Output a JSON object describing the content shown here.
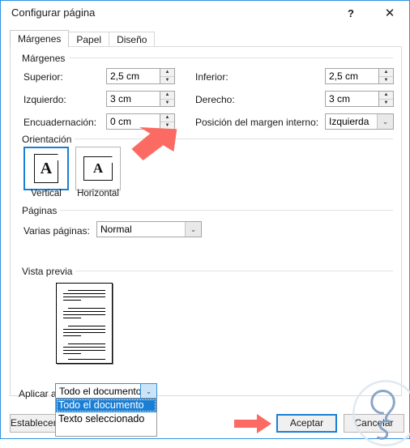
{
  "window": {
    "title": "Configurar página",
    "help_label": "?",
    "close_label": "✕"
  },
  "tabs": [
    {
      "label": "Márgenes",
      "active": true
    },
    {
      "label": "Papel",
      "active": false
    },
    {
      "label": "Diseño",
      "active": false
    }
  ],
  "margins_group": {
    "legend": "Márgenes",
    "fields": [
      {
        "label": "Superior:",
        "value": "2,5 cm",
        "control": "spinner"
      },
      {
        "label": "Izquierdo:",
        "value": "3 cm",
        "control": "spinner"
      },
      {
        "label": "Encuadernación:",
        "value": "0 cm",
        "control": "spinner"
      },
      {
        "label": "Inferior:",
        "value": "2,5 cm",
        "control": "spinner"
      },
      {
        "label": "Derecho:",
        "value": "3 cm",
        "control": "spinner"
      },
      {
        "label": "Posición del margen interno:",
        "value": "Izquierda",
        "control": "combo"
      }
    ],
    "spin_up": "▲",
    "spin_down": "▼"
  },
  "orientation_group": {
    "legend": "Orientación",
    "options": [
      {
        "label": "Vertical",
        "selected": true,
        "glyph": "A"
      },
      {
        "label": "Horizontal",
        "selected": false,
        "glyph": "A"
      }
    ]
  },
  "pages_group": {
    "legend": "Páginas",
    "multiple_pages_label": "Varias páginas:",
    "multiple_pages_value": "Normal"
  },
  "preview_group": {
    "legend": "Vista previa"
  },
  "apply_to": {
    "label": "Aplicar a:",
    "value": "Todo el documento",
    "expanded": true,
    "options": [
      {
        "label": "Todo el documento",
        "selected": true
      },
      {
        "label": "Texto seleccionado",
        "selected": false
      }
    ]
  },
  "buttons": {
    "set_default": "Establecer como predeterminado",
    "ok": "Aceptar",
    "cancel": "Cancelar"
  },
  "colors": {
    "dialog_border": "#2f93e0",
    "accent_blue": "#1a7fd4",
    "annotation_red": "#fb6b63",
    "selection_blue": "#1a7fd4",
    "watermark_blue": "#7f9fc4"
  },
  "annotations": [
    {
      "name": "arrow-to-gutter-spinner",
      "direction": "down-left"
    },
    {
      "name": "arrow-to-ok-button",
      "direction": "right"
    }
  ]
}
